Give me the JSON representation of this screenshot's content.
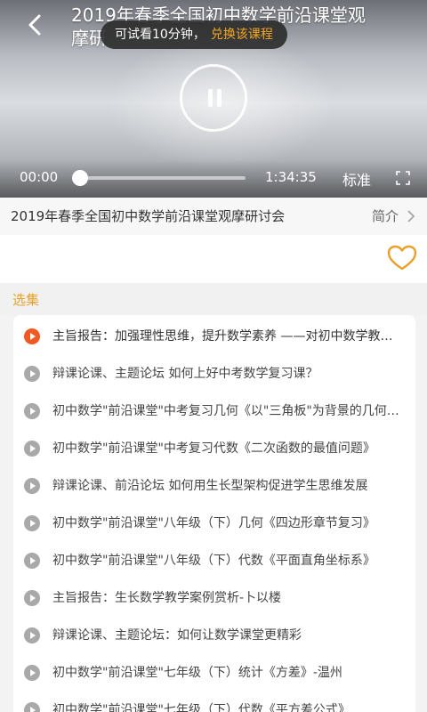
{
  "player": {
    "title_line1": "2019年春季全国初中数学前沿课堂观",
    "title_line2": "摩研",
    "trial_text": "可试看10分钟，",
    "trial_link": "兑换该课程",
    "current_time": "00:00",
    "total_time": "1:34:35",
    "quality": "标准",
    "progress": 0,
    "icons": {
      "back": "back-arrow-icon",
      "pause": "pause-icon",
      "fullscreen": "fullscreen-icon"
    }
  },
  "course": {
    "name": "2019年春季全国初中数学前沿课堂观摩研讨会",
    "intro_label": "简介",
    "favorite_icon": "heart-icon"
  },
  "episodes_section": {
    "label": "选集",
    "items": [
      {
        "title": "主旨报告：加强理性思维，提升数学素养 ——对初中数学教学的思考",
        "active": true
      },
      {
        "title": "辩课论课、主题论坛 如何上好中考数学复习课？",
        "active": false
      },
      {
        "title": "初中数学\"前沿课堂\"中考复习几何《以\"三角板\"为背景的几何问题》",
        "active": false
      },
      {
        "title": "初中数学\"前沿课堂\"中考复习代数《二次函数的最值问题》",
        "active": false
      },
      {
        "title": "辩课论课、前沿论坛 如何用生长型架构促进学生思维发展",
        "active": false
      },
      {
        "title": "初中数学\"前沿课堂\"八年级（下）几何《四边形章节复习》",
        "active": false
      },
      {
        "title": "初中数学\"前沿课堂\"八年级（下）代数《平面直角坐标系》",
        "active": false
      },
      {
        "title": "主旨报告：生长数学教学案例赏析-卜以楼",
        "active": false
      },
      {
        "title": "辩课论课、主题论坛：如何让数学课堂更精彩",
        "active": false
      },
      {
        "title": "初中数学\"前沿课堂\"七年级（下）统计《方差》-温州",
        "active": false
      },
      {
        "title": "初中数学\"前沿课堂\"七年级（下）代数《平方差公式》",
        "active": false
      }
    ]
  },
  "colors": {
    "accent": "#e8a12a",
    "play_active": "#f05a22",
    "play_inactive": "#a9a9a9",
    "trial_link": "#f5a623"
  }
}
